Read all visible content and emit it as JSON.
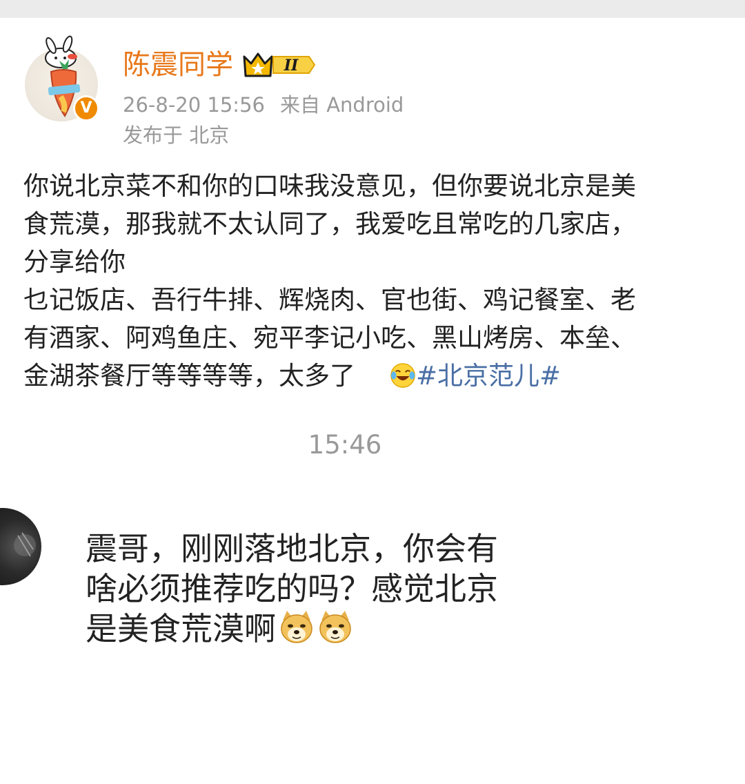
{
  "post": {
    "author": "陈震同学",
    "level_badge": "II",
    "time": "26-8-20 15:56",
    "source": "来自 Android",
    "location": "发布于 北京",
    "lines": [
      "你说北京菜不和你的口味我没意见，但你要说北京是美",
      "食荒漠，那我就不太认同了，我爱吃且常吃的几家店，",
      "分享给你",
      "乜记饭店、吾行牛排、辉烧肉、官也街、鸡记餐室、老",
      "有酒家、阿鸡鱼庄、宛平李记小吃、黑山烤房、本垒、"
    ],
    "last_line": "金湖茶餐厅等等等等，太多了",
    "hashtag": "#北京范儿#",
    "emoji": "laugh-cry-icon",
    "verified": "V"
  },
  "chat": {
    "time": "15:46",
    "message_lines": [
      "震哥，刚刚落地北京，你会有",
      "啥必须推荐吃的吗？感觉北京"
    ],
    "message_last": "是美食荒漠啊",
    "emojis": [
      "doge-icon",
      "doge-icon"
    ]
  },
  "colors": {
    "username": "#e8781a",
    "meta": "#999999",
    "hashtag": "#4a6fa5",
    "badge": "#f08a00"
  }
}
